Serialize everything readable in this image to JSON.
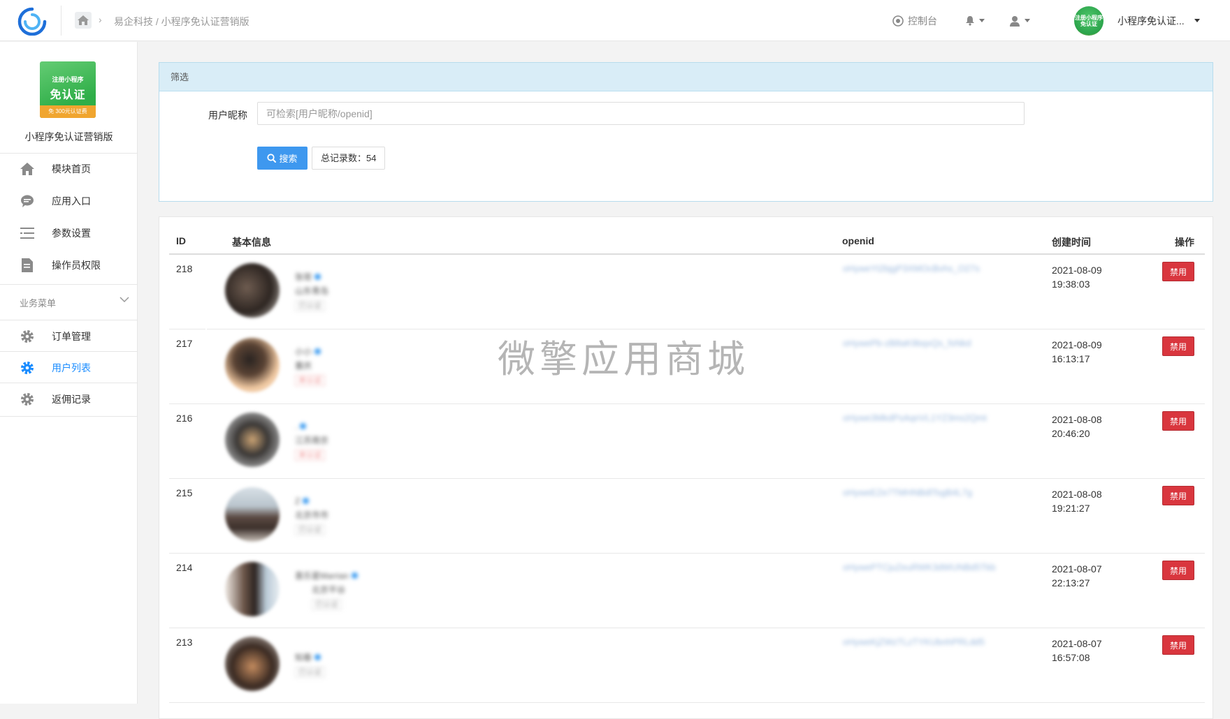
{
  "breadcrumb": {
    "company": "易企科技",
    "separator": "/",
    "app": "小程序免认证营销版"
  },
  "header": {
    "console_label": "控制台",
    "account_name": "小程序免认证...",
    "account_avatar_text": "注册小程序免认证"
  },
  "sidebar": {
    "app_logo": {
      "line1": "注册小程序",
      "line2": "免认证",
      "line3": "免 300元认证费"
    },
    "app_name": "小程序免认证营销版",
    "items": [
      {
        "label": "模块首页",
        "icon": "home-icon"
      },
      {
        "label": "应用入口",
        "icon": "chat-icon"
      },
      {
        "label": "参数设置",
        "icon": "list-icon"
      },
      {
        "label": "操作员权限",
        "icon": "document-icon"
      }
    ],
    "group_label": "业务菜单",
    "business_items": [
      {
        "label": "订单管理",
        "icon": "gear-icon"
      },
      {
        "label": "用户列表",
        "icon": "gear-icon",
        "active": true
      },
      {
        "label": "返佣记录",
        "icon": "gear-icon"
      }
    ]
  },
  "filter": {
    "title": "筛选",
    "nickname_label": "用户昵称",
    "nickname_placeholder": "可检索[用户昵称/openid]",
    "search_label": "搜索",
    "total_label": "总记录数：54"
  },
  "table": {
    "columns": {
      "id": "ID",
      "info": "基本信息",
      "openid": "openid",
      "created": "创建时间",
      "action": "操作"
    },
    "ban_label": "禁用",
    "rows": [
      {
        "id": "218",
        "name": "张哥",
        "region": "山东青岛",
        "tag": "已认证",
        "openid": "oHyweYt2bjgP3XMOcBvhs_O27s",
        "date": "2021-08-09",
        "time": "19:38:03"
      },
      {
        "id": "217",
        "name": "小小",
        "region": "重庆",
        "tag": "未认证",
        "openid": "oHywePb-zB8aK9bqxQs_fsNkd",
        "date": "2021-08-09",
        "time": "16:13:17"
      },
      {
        "id": "216",
        "name": ".",
        "region": "江苏南京",
        "tag": "未认证",
        "openid": "oHywe3MkdPsAqnVL1YZ3ms2Qmt",
        "date": "2021-08-08",
        "time": "20:46:20"
      },
      {
        "id": "215",
        "name": "Z",
        "region": "北京市市",
        "tag": "已认证",
        "openid": "oHyweEZe7TMHNBdlTsgB4L7g",
        "date": "2021-08-08",
        "time": "19:21:27"
      },
      {
        "id": "214",
        "name": "喜乐星Marrian",
        "region": "北京平谷",
        "tag": "已认证",
        "openid": "oHywePTCjuZeuRWK3dWUNBd5Tkb",
        "date": "2021-08-07",
        "time": "22:13:27"
      },
      {
        "id": "213",
        "name": "知春",
        "region": "已认证",
        "tag": "",
        "openid": "oHyweKjZWzTLzTYKUbnhPRLdd5",
        "date": "2021-08-07",
        "time": "16:57:08"
      }
    ]
  },
  "watermark": "微擎应用商城",
  "colors": {
    "primary": "#3e98ef",
    "danger": "#d9363e",
    "filter_head": "#d9edf7",
    "active_nav": "#1a8cff"
  }
}
